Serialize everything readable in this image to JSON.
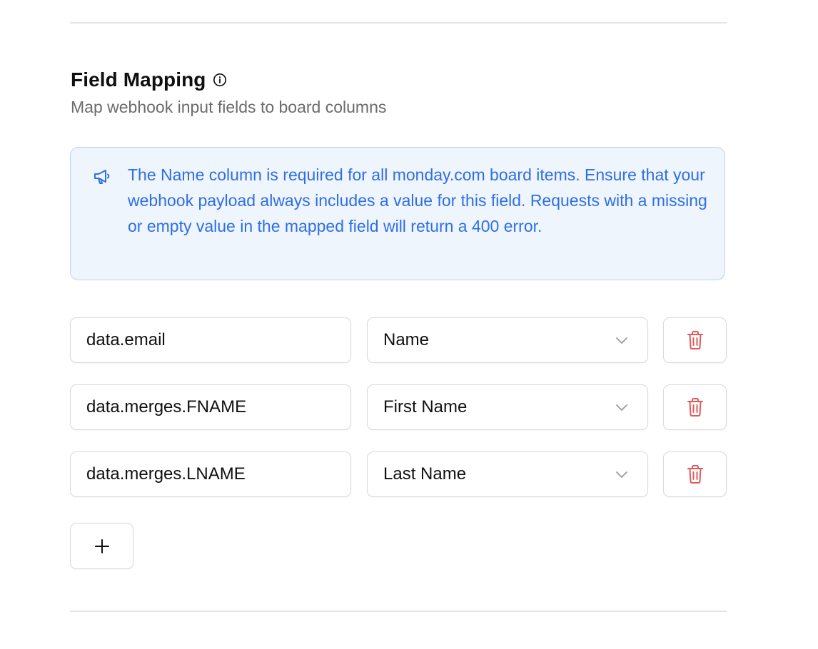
{
  "section": {
    "title": "Field Mapping",
    "subtitle": "Map webhook input fields to board columns"
  },
  "notice": {
    "icon": "megaphone-icon",
    "text": "The Name column is required for all monday.com board items. Ensure that your webhook payload always includes a value for this field. Requests with a missing or empty value in the mapped field will return a 400 error."
  },
  "mappings": [
    {
      "source": "data.email",
      "target": "Name"
    },
    {
      "source": "data.merges.FNAME",
      "target": "First Name"
    },
    {
      "source": "data.merges.LNAME",
      "target": "Last Name"
    }
  ],
  "add_button": {
    "label": "+"
  },
  "colors": {
    "notice_text": "#2f6ee6",
    "notice_bg": "#eef5fd",
    "notice_border": "#bcd3f2",
    "delete_icon": "#e15b5b",
    "subtitle": "#6b6b6b"
  }
}
